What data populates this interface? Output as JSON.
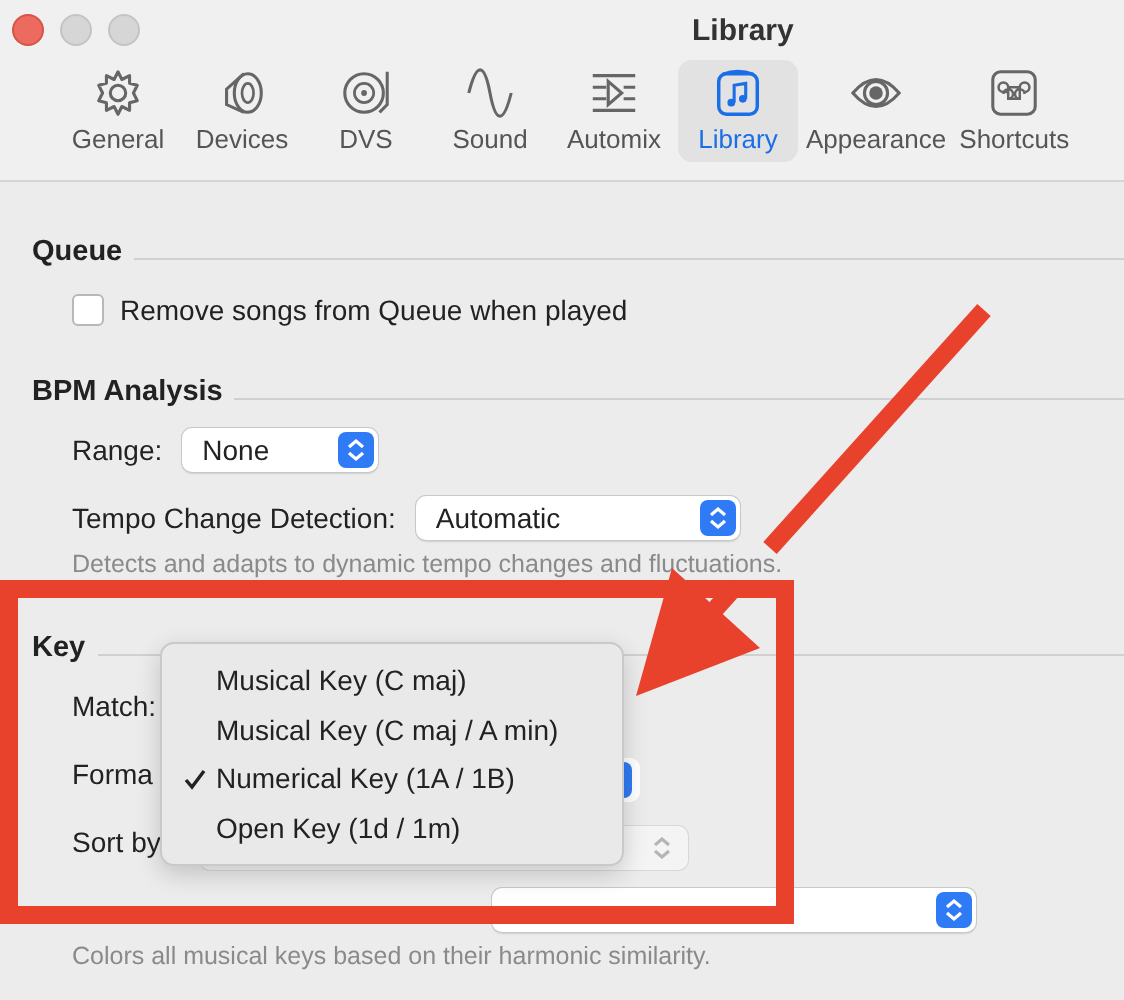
{
  "window": {
    "title": "Library"
  },
  "toolbar": [
    {
      "label": "General",
      "selected": false
    },
    {
      "label": "Devices",
      "selected": false
    },
    {
      "label": "DVS",
      "selected": false
    },
    {
      "label": "Sound",
      "selected": false
    },
    {
      "label": "Automix",
      "selected": false
    },
    {
      "label": "Library",
      "selected": true
    },
    {
      "label": "Appearance",
      "selected": false
    },
    {
      "label": "Shortcuts",
      "selected": false
    }
  ],
  "sections": [
    {
      "title": "Queue",
      "rows": [
        {
          "kind": "checkbox",
          "label": "Remove songs from Queue when played",
          "checked": false
        }
      ]
    },
    {
      "title": "BPM Analysis",
      "rows": [
        {
          "kind": "popup",
          "label": "Range:",
          "value": "None"
        },
        {
          "kind": "popup",
          "label": "Tempo Change Detection:",
          "value": "Automatic"
        },
        {
          "kind": "note",
          "text": "Detects and adapts to dynamic tempo changes and fluctuations."
        }
      ]
    },
    {
      "title": "Key",
      "rows": [
        {
          "kind": "label",
          "label": "Match:"
        },
        {
          "kind": "label",
          "label": "Forma"
        },
        {
          "kind": "label",
          "label": "Sort by"
        },
        {
          "kind": "popup"
        },
        {
          "kind": "note",
          "text": "Colors all musical keys based on their harmonic similarity."
        }
      ]
    }
  ],
  "menu": [
    {
      "label": "Musical Key (C maj)",
      "selected": false
    },
    {
      "label": "Musical Key (C maj / A min)",
      "selected": false
    },
    {
      "label": "Numerical Key (1A / 1B)",
      "selected": true
    },
    {
      "label": "Open Key (1d / 1m)",
      "selected": false
    }
  ]
}
